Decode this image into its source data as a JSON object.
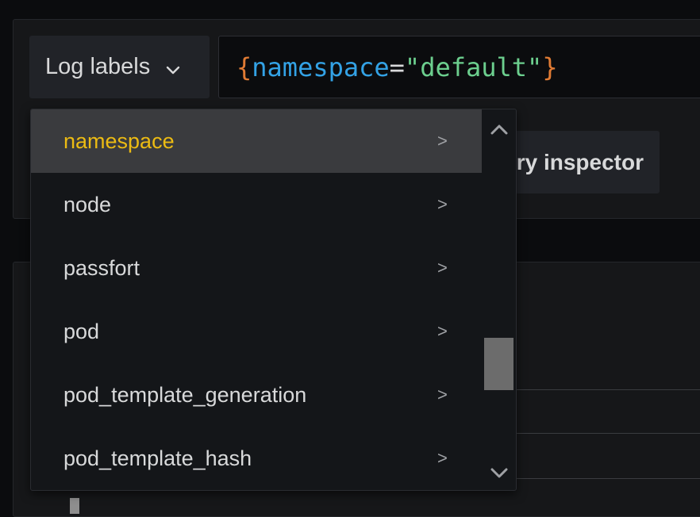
{
  "query_row": {
    "log_labels_label": "Log labels",
    "query": {
      "open_brace": "{",
      "key": "namespace",
      "operator": "=",
      "value": "\"default\"",
      "close_brace": "}"
    }
  },
  "secondary_row": {
    "inspector_label": "ry inspector"
  },
  "label_dropdown": {
    "items": [
      {
        "label": "namespace",
        "arrow": ">"
      },
      {
        "label": "node",
        "arrow": ">"
      },
      {
        "label": "passfort",
        "arrow": ">"
      },
      {
        "label": "pod",
        "arrow": ">"
      },
      {
        "label": "pod_template_generation",
        "arrow": ">"
      },
      {
        "label": "pod_template_hash",
        "arrow": ">"
      }
    ],
    "active_index": 0
  },
  "colors": {
    "active_item_text": "#ecbb13",
    "brace": "#e07b34",
    "key": "#33a2e5",
    "string": "#6ccf8e"
  }
}
